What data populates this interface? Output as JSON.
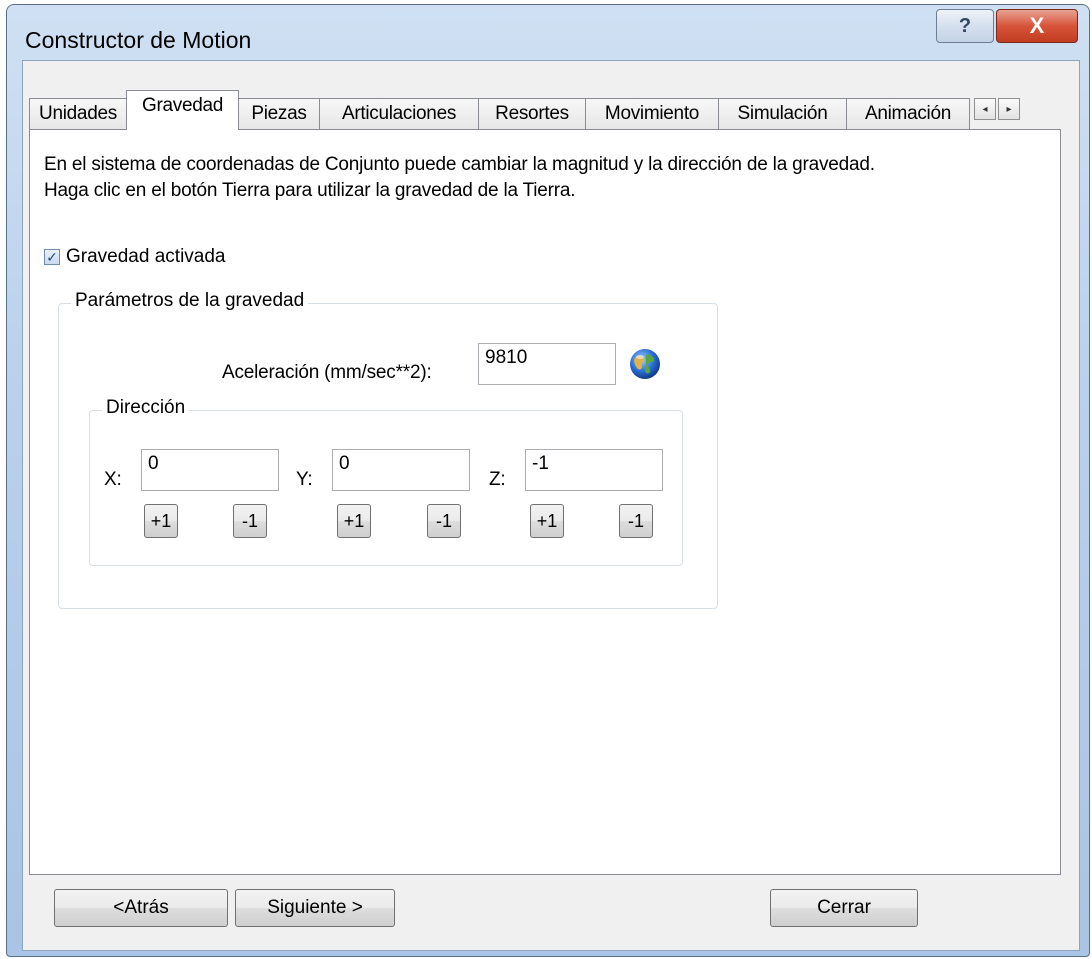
{
  "window": {
    "title": "Constructor de Motion",
    "help_label": "?",
    "close_label": "X"
  },
  "tabs": [
    {
      "label": "Unidades",
      "active": false
    },
    {
      "label": "Gravedad",
      "active": true
    },
    {
      "label": "Piezas",
      "active": false
    },
    {
      "label": "Articulaciones",
      "active": false
    },
    {
      "label": "Resortes",
      "active": false
    },
    {
      "label": "Movimiento",
      "active": false
    },
    {
      "label": "Simulación",
      "active": false
    },
    {
      "label": "Animación",
      "active": false
    }
  ],
  "tab_scroll": {
    "left": "◂",
    "right": "▸"
  },
  "page": {
    "description_line1": "En el sistema de coordenadas de Conjunto puede cambiar la magnitud y la dirección de la gravedad.",
    "description_line2": "Haga clic en el botón Tierra para utilizar la gravedad de la Tierra.",
    "gravity_enabled": {
      "label": "Gravedad activada",
      "checked": true
    },
    "gravity_params": {
      "legend": "Parámetros de la gravedad",
      "acceleration_label": "Aceleración (mm/sec**2):",
      "acceleration_value": "9810",
      "earth_button_icon": "earth-globe-icon"
    },
    "direction": {
      "legend": "Dirección",
      "x_label": "X:",
      "x_value": "0",
      "y_label": "Y:",
      "y_value": "0",
      "z_label": "Z:",
      "z_value": "-1",
      "plus_label": "+1",
      "minus_label": "-1"
    }
  },
  "footer": {
    "back_label": "<Atrás",
    "next_label": "Siguiente >",
    "close_label": "Cerrar"
  }
}
